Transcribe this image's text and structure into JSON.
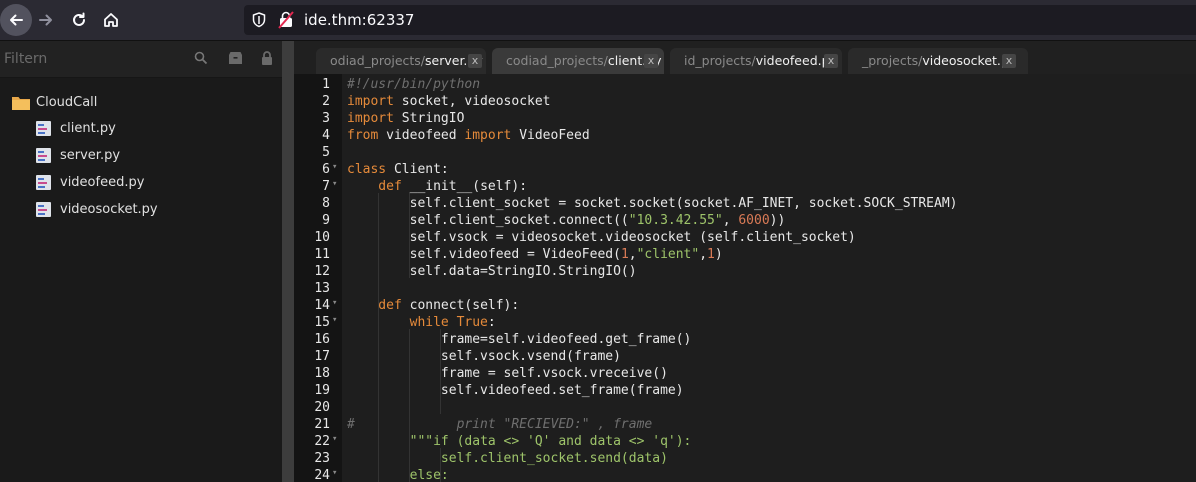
{
  "browser": {
    "url": "ide.thm:62337"
  },
  "sidebar": {
    "filter_placeholder": "Filtern",
    "folder": "CloudCall",
    "files": [
      "client.py",
      "server.py",
      "videofeed.py",
      "videosocket.py"
    ]
  },
  "tabs": [
    {
      "prefix": "odiad_projects/",
      "name": "server.py",
      "close": "x",
      "active": false
    },
    {
      "prefix": "codiad_projects/",
      "name": "client.py",
      "close": "x",
      "active": true
    },
    {
      "prefix": "id_projects/",
      "name": "videofeed.py",
      "close": "x",
      "active": false
    },
    {
      "prefix": "_projects/",
      "name": "videosocket.py",
      "close": "x",
      "active": false
    }
  ],
  "editor": {
    "lines": [
      {
        "n": "1",
        "fold": false
      },
      {
        "n": "2",
        "fold": false
      },
      {
        "n": "3",
        "fold": false
      },
      {
        "n": "4",
        "fold": false
      },
      {
        "n": "5",
        "fold": false
      },
      {
        "n": "6",
        "fold": true
      },
      {
        "n": "7",
        "fold": true
      },
      {
        "n": "8",
        "fold": false
      },
      {
        "n": "9",
        "fold": false
      },
      {
        "n": "10",
        "fold": false
      },
      {
        "n": "11",
        "fold": false
      },
      {
        "n": "12",
        "fold": false
      },
      {
        "n": "13",
        "fold": false
      },
      {
        "n": "14",
        "fold": true
      },
      {
        "n": "15",
        "fold": true
      },
      {
        "n": "16",
        "fold": false
      },
      {
        "n": "17",
        "fold": false
      },
      {
        "n": "18",
        "fold": false
      },
      {
        "n": "19",
        "fold": false
      },
      {
        "n": "20",
        "fold": false
      },
      {
        "n": "21",
        "fold": false
      },
      {
        "n": "22",
        "fold": true
      },
      {
        "n": "23",
        "fold": false
      },
      {
        "n": "24",
        "fold": true
      }
    ],
    "code": {
      "l1": "#!/usr/bin/python",
      "l2a": "import",
      "l2b": " socket, videosocket",
      "l3a": "import",
      "l3b": " StringIO",
      "l4a": "from",
      "l4b": " videofeed ",
      "l4c": "import",
      "l4d": " VideoFeed",
      "l6a": "class",
      "l6b": " Client:",
      "l7a": "    def",
      "l7b": " __init__(self):",
      "l8": "        self.client_socket = socket.socket(socket.AF_INET, socket.SOCK_STREAM)",
      "l9a": "        self.client_socket.connect((",
      "l9b": "\"10.3.42.55\"",
      "l9c": ", ",
      "l9d": "6000",
      "l9e": "))",
      "l10": "        self.vsock = videosocket.videosocket (self.client_socket)",
      "l11a": "        self.videofeed = VideoFeed(",
      "l11b": "1",
      "l11c": ",",
      "l11d": "\"client\"",
      "l11e": ",",
      "l11f": "1",
      "l11g": ")",
      "l12": "        self.data=StringIO.StringIO()",
      "l14a": "    def",
      "l14b": " connect(self):",
      "l15a": "        while",
      "l15b": " True",
      "l15c": ":",
      "l16": "            frame=self.videofeed.get_frame()",
      "l17": "            self.vsock.vsend(frame)",
      "l18": "            frame = self.vsock.vreceive()",
      "l19": "            self.videofeed.set_frame(frame)",
      "l21": "#             print \"RECIEVED:\" , frame",
      "l22a": "        ",
      "l22b": "\"\"\"if (data <> 'Q' and data <> 'q'):",
      "l23": "            self.client_socket.send(data)",
      "l24a": "        ",
      "l24b": "else:"
    }
  }
}
